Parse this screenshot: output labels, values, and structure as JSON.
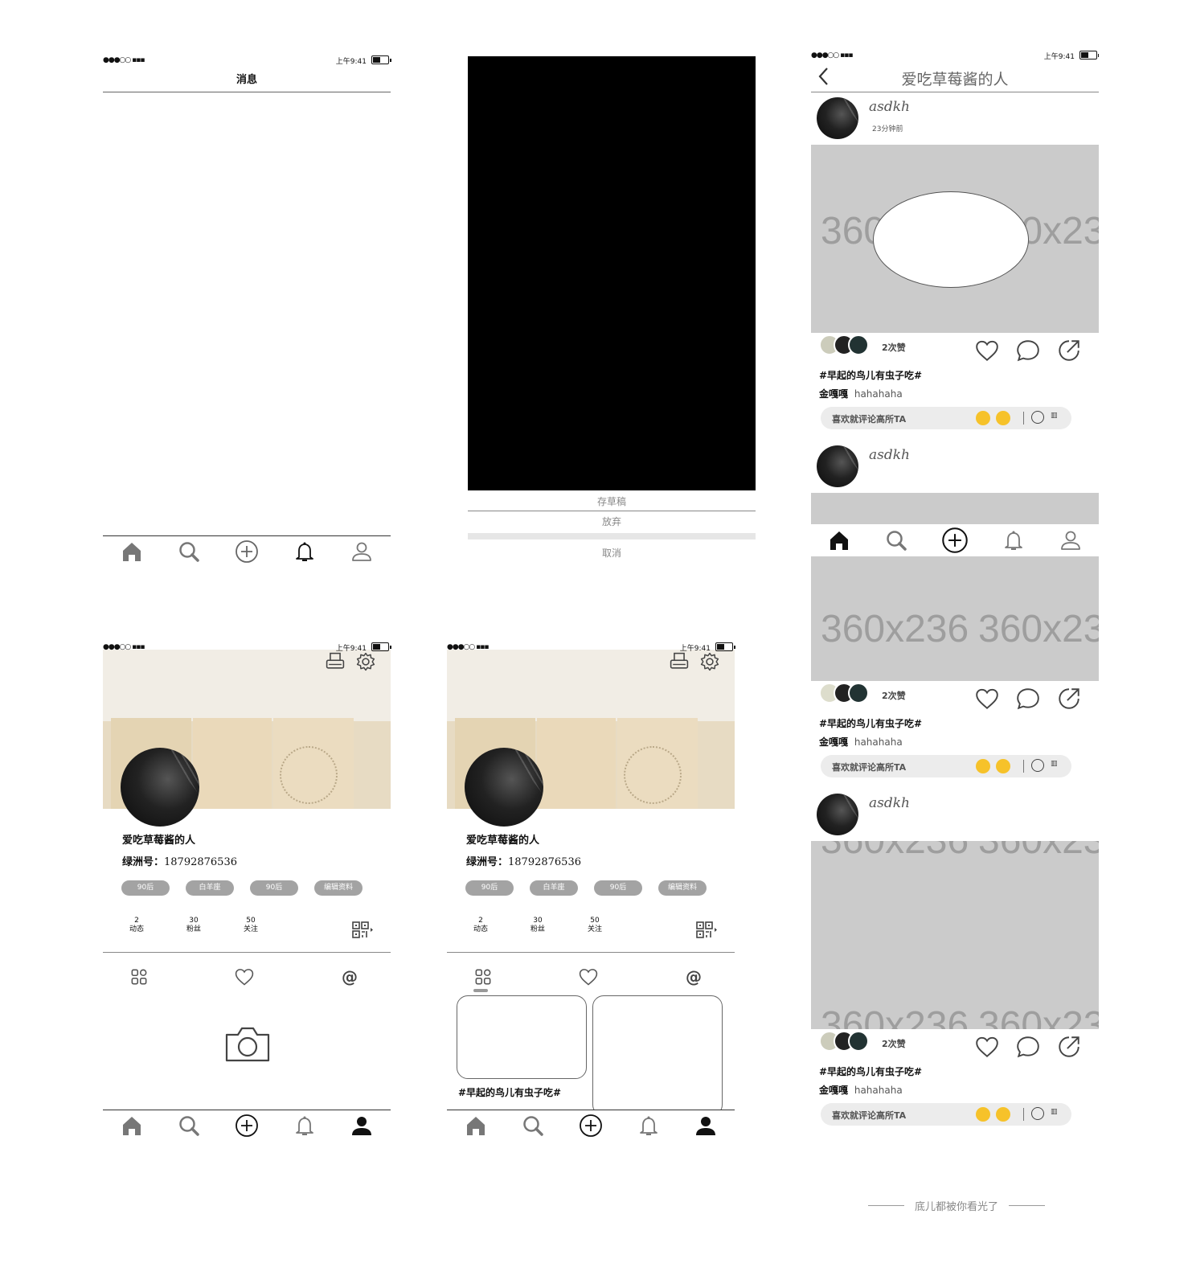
{
  "status_bar": {
    "time": "上午9:41"
  },
  "messages_screen": {
    "title": "消息"
  },
  "publish_screen": {
    "actions": [
      "存草稿",
      "放弃"
    ],
    "cancel": "取消"
  },
  "profile": {
    "name": "爱吃草莓酱的人",
    "id_label": "绿洲号：",
    "id_value": "18792876536",
    "tags": [
      "90后",
      "白羊座",
      "90后"
    ],
    "edit_button": "编辑资料",
    "stats": [
      {
        "value": "2",
        "label": "动态"
      },
      {
        "value": "30",
        "label": "粉丝"
      },
      {
        "value": "50",
        "label": "关注"
      }
    ],
    "tab_at": "@"
  },
  "profile_with_posts": {
    "post_title": "#早起的鸟儿有虫子吃#"
  },
  "feed": {
    "title": "爱吃草莓酱的人",
    "image_placeholder": "360x236",
    "posts": [
      {
        "author": "asdkh",
        "time": "23分钟前",
        "likes": "2次赞",
        "topic": "#早起的鸟儿有虫子吃#",
        "commenter": "金嘎嘎",
        "comment": "hahahaha",
        "comment_prompt": "喜欢就评论高所TA"
      },
      {
        "author": "asdkh",
        "time": "",
        "likes": "2次赞",
        "topic": "#早起的鸟儿有虫子吃#",
        "commenter": "金嘎嘎",
        "comment": "hahahaha",
        "comment_prompt": "喜欢就评论高所TA"
      },
      {
        "author": "asdkh",
        "time": "",
        "likes": "2次赞",
        "topic": "#早起的鸟儿有虫子吃#",
        "commenter": "金嘎嘎",
        "comment": "hahahaha",
        "comment_prompt": "喜欢就评论高所TA"
      }
    ],
    "end_text": "底儿都被你看光了"
  }
}
